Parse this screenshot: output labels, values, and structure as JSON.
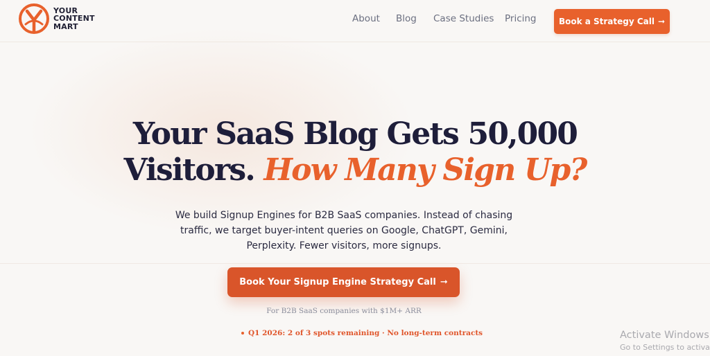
{
  "brand": {
    "name_lines": [
      "YOUR",
      "CONTENT",
      "MART"
    ],
    "logo_letter": "Y",
    "logo_icon": "brand-logo-icon"
  },
  "nav": {
    "about": "About",
    "blog": "Blog",
    "case_studies": "Case Studies",
    "pricing": "Pricing"
  },
  "header_cta": {
    "label": "Book a Strategy Call",
    "arrow": "➞"
  },
  "hero": {
    "headline_line1": "Your SaaS Blog Gets 50,000",
    "headline_line2_plain": "Visitors.",
    "headline_line2_accent": "How Many Sign Up?",
    "subtext": "We build Signup Engines for B2B SaaS companies. Instead of chasing traffic, we target buyer-intent queries on Google, ChatGPT, Gemini, Perplexity. Fewer visitors, more signups.",
    "cta_label": "Book Your Signup Engine Strategy Call",
    "cta_arrow": "➞",
    "audience_note": "For B2B SaaS companies with $1M+ ARR",
    "spots_text": "Q1 2026: 2 of 3 spots remaining · No long-term contracts"
  },
  "watermark": {
    "title": "Activate Windows",
    "subtitle": "Go to Settings to activate"
  },
  "colors": {
    "accent": "#e8612c",
    "accent_dark": "#d9552a",
    "heading": "#1e1e3a",
    "nav_text": "#6b6f80",
    "background": "#f9f7f5"
  }
}
